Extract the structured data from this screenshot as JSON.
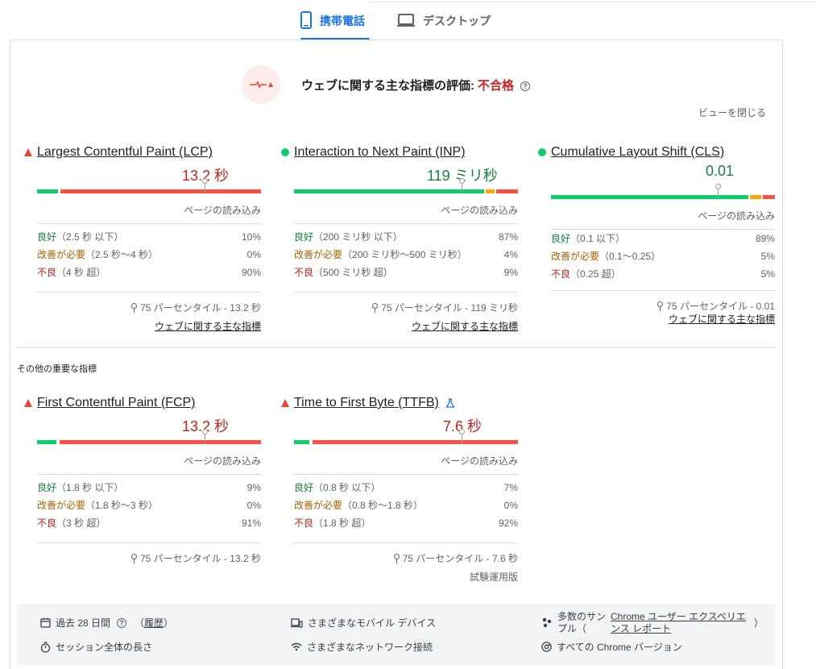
{
  "tabs": [
    {
      "label": "携帯電話",
      "icon": "phone-icon",
      "active": true
    },
    {
      "label": "デスクトップ",
      "icon": "desktop-icon",
      "active": false
    }
  ],
  "verdict": {
    "label": "ウェブに関する主な指標の評価:",
    "status": "不合格",
    "help": "?"
  },
  "close_view": "ビューを閉じる",
  "colors": {
    "good": "#0cce6b",
    "needs_improvement": "#ffa400",
    "poor": "#ff4e42",
    "accent": "#1a73e8",
    "fail": "#c5221f"
  },
  "core_metrics": [
    {
      "name": "Largest Contentful Paint (LCP)",
      "status": "poor",
      "value": "13.2 秒",
      "load_label": "ページの読み込み",
      "distribution": {
        "good": {
          "label": "良好",
          "range": "（2.5 秒 以下）",
          "pct": "10%"
        },
        "ni": {
          "label": "改善が必要",
          "range": "（2.5 秒〜4 秒）",
          "pct": "0%"
        },
        "poor": {
          "label": "不良",
          "range": "（4 秒 超）",
          "pct": "90%"
        }
      },
      "percentile": "75 パーセンタイル - 13.2 秒",
      "link": "ウェブに関する主な指標"
    },
    {
      "name": "Interaction to Next Paint (INP)",
      "status": "good",
      "value": "119 ミリ秒",
      "load_label": "ページの読み込み",
      "distribution": {
        "good": {
          "label": "良好",
          "range": "（200 ミリ秒 以下）",
          "pct": "87%"
        },
        "ni": {
          "label": "改善が必要",
          "range": "（200 ミリ秒〜500 ミリ秒）",
          "pct": "4%"
        },
        "poor": {
          "label": "不良",
          "range": "（500 ミリ秒 超）",
          "pct": "9%"
        }
      },
      "percentile": "75 パーセンタイル - 119 ミリ秒",
      "link": "ウェブに関する主な指標"
    },
    {
      "name": "Cumulative Layout Shift (CLS)",
      "status": "good",
      "value": "0.01",
      "load_label": "ページの読み込み",
      "distribution": {
        "good": {
          "label": "良好",
          "range": "（0.1 以下）",
          "pct": "89%"
        },
        "ni": {
          "label": "改善が必要",
          "range": "（0.1〜0.25）",
          "pct": "5%"
        },
        "poor": {
          "label": "不良",
          "range": "（0.25 超）",
          "pct": "5%"
        }
      },
      "percentile": "75 パーセンタイル - 0.01",
      "link": "ウェブに関する主な指標"
    }
  ],
  "other_heading": "その他の重要な指標",
  "other_metrics": [
    {
      "name": "First Contentful Paint (FCP)",
      "status": "poor",
      "value": "13.2 秒",
      "load_label": "ページの読み込み",
      "distribution": {
        "good": {
          "label": "良好",
          "range": "（1.8 秒 以下）",
          "pct": "9%"
        },
        "ni": {
          "label": "改善が必要",
          "range": "（1.8 秒〜3 秒）",
          "pct": "0%"
        },
        "poor": {
          "label": "不良",
          "range": "（3 秒 超）",
          "pct": "91%"
        }
      },
      "percentile": "75 パーセンタイル - 13.2 秒"
    },
    {
      "name": "Time to First Byte (TTFB)",
      "status": "poor",
      "value": "7.6 秒",
      "load_label": "ページの読み込み",
      "distribution": {
        "good": {
          "label": "良好",
          "range": "（0.8 秒 以下）",
          "pct": "7%"
        },
        "ni": {
          "label": "改善が必要",
          "range": "（0.8 秒〜1.8 秒）",
          "pct": "0%"
        },
        "poor": {
          "label": "不良",
          "range": "（1.8 秒 超）",
          "pct": "92%"
        }
      },
      "percentile": "75 パーセンタイル - 7.6 秒",
      "experimental": "試験運用版"
    }
  ],
  "footer": {
    "period": "過去 28 日間",
    "history": "履歴",
    "session": "セッション全体の長さ",
    "devices": "さまざまなモバイル デバイス",
    "network": "さまざまなネットワーク接続",
    "samples_prefix": "多数のサンプル（",
    "samples_link": "Chrome ユーザー エクスペリエンス レポート",
    "samples_suffix": "）",
    "versions": "すべての Chrome バージョン"
  }
}
